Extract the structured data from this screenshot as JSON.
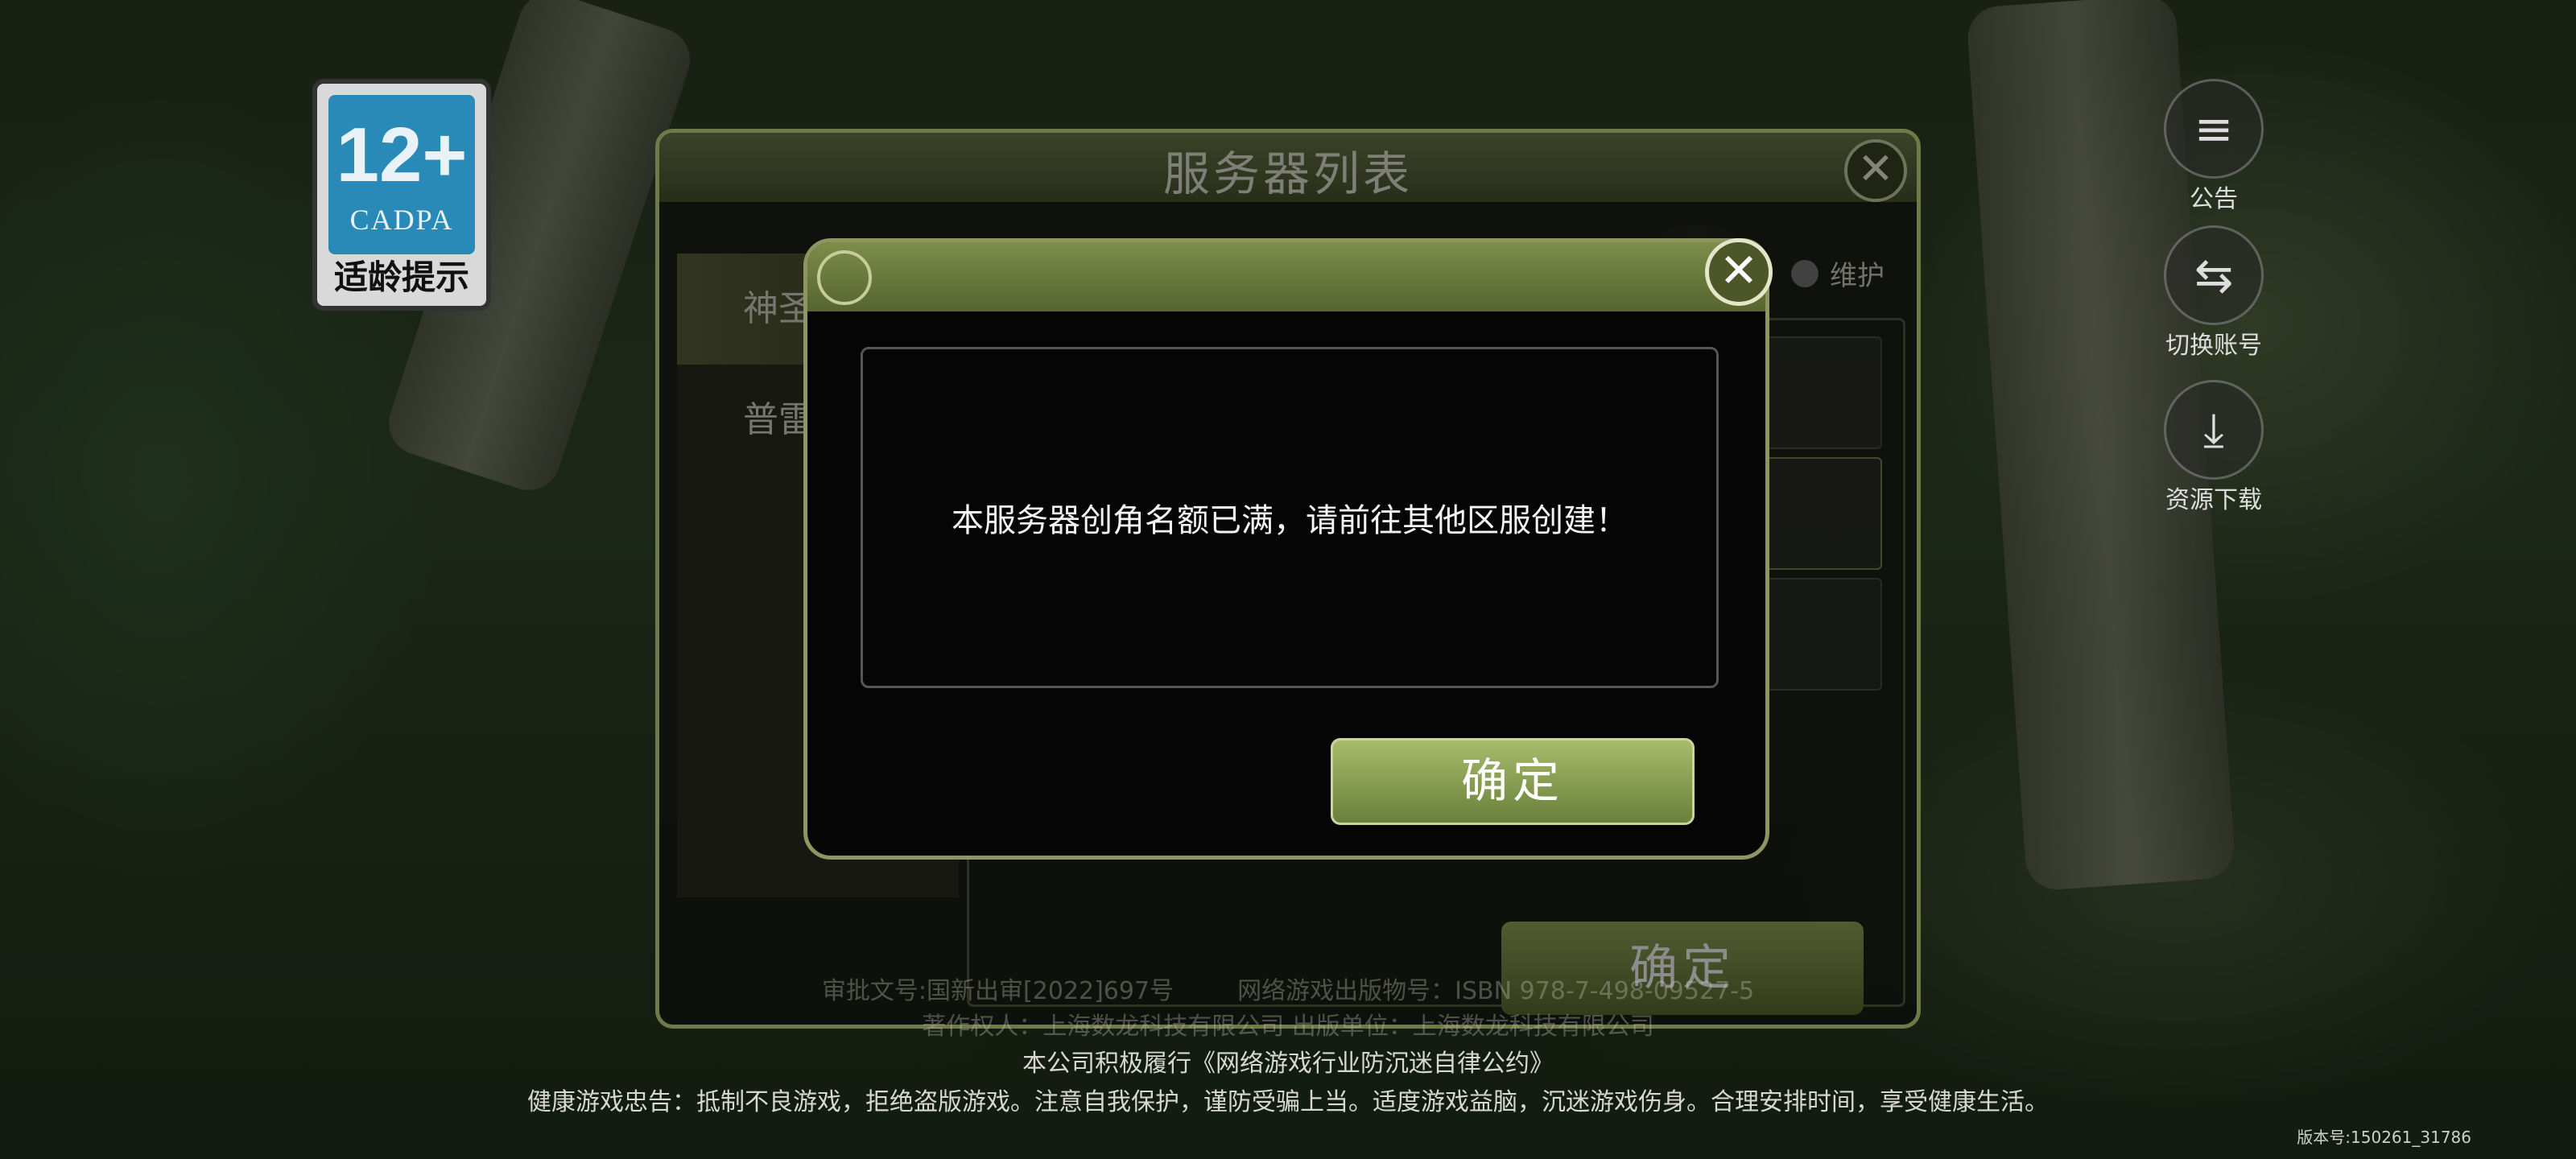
{
  "age_badge": {
    "number": "12+",
    "org": "CADPA",
    "hint": "适龄提示"
  },
  "side_buttons": [
    {
      "label": "公告",
      "icon": "announcement-icon",
      "glyph": "≡"
    },
    {
      "label": "切换账号",
      "icon": "switch-account-icon",
      "glyph": "⇆"
    },
    {
      "label": "资源下载",
      "icon": "download-icon",
      "glyph": "⤓"
    }
  ],
  "server_panel": {
    "title": "服务器列表",
    "tabs": [
      "神圣...",
      "普雷利..."
    ],
    "legend_maintenance": "维护",
    "confirm_label": "确定"
  },
  "dialog": {
    "message": "本服务器创角名额已满，请前往其他区服创建！",
    "confirm_label": "确定"
  },
  "footer": {
    "approval": "审批文号:国新出审[2022]697号",
    "isbn": "网络游戏出版物号：ISBN 978-7-498-09527-5",
    "publisher": "著作权人：上海数龙科技有限公司  出版单位：上海数龙科技有限公司",
    "pledge": "本公司积极履行《网络游戏行业防沉迷自律公约》",
    "health": "健康游戏忠告：抵制不良游戏，拒绝盗版游戏。注意自我保护，谨防受骗上当。适度游戏益脑，沉迷游戏伤身。合理安排时间，享受健康生活。"
  },
  "version": "版本号:150261_31786"
}
